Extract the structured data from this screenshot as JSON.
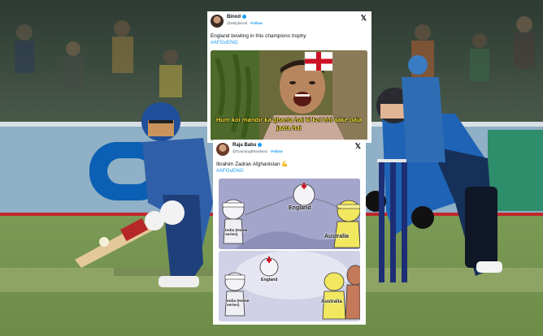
{
  "tweet1": {
    "author_name": "Binod",
    "author_handle": "@wittybinod",
    "follow_label": "Follow",
    "platform_icon": "x-logo",
    "text": "England bowling in this champions trophy",
    "hashtag": "#AFGvENG",
    "meme_caption": "Hum koi mandir ka ghanta hai ki koi bhi aake baja jaata hai"
  },
  "tweet2": {
    "author_name": "Raja Babu",
    "author_handle": "@GaurangBhardwa1",
    "follow_label": "Follow",
    "platform_icon": "x-logo",
    "text": "Ibrahim Zadran Afghanistan 💪",
    "hashtag": "#AFGvENG",
    "panel1_labels": {
      "england": "England",
      "india": "India (Home series)",
      "australia": "Australia"
    },
    "panel2_labels": {
      "england": "England",
      "india": "India (Home series)",
      "australia": "Australia"
    }
  },
  "colors": {
    "link_blue": "#1d9bf0",
    "caption_yellow": "#ffeb3b",
    "afghanistan_kit": "#2f5fa8",
    "england_kit": "#1e63b5"
  }
}
